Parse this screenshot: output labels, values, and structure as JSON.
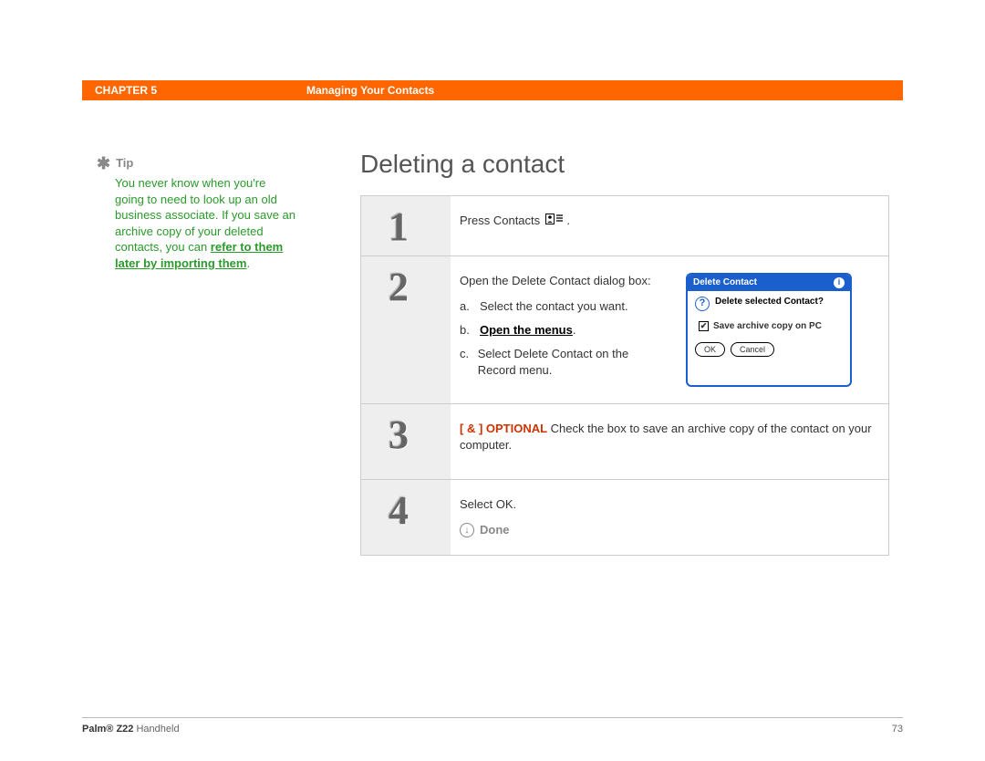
{
  "header": {
    "chapter_label": "CHAPTER 5",
    "chapter_title": "Managing Your Contacts"
  },
  "sidebar": {
    "tip_label": "Tip",
    "tip_text_before": "You never know when you're going to need to look up an old business associate. If you save an archive copy of your deleted contacts, you can ",
    "tip_link": "refer to them later by importing them",
    "tip_text_after": "."
  },
  "main": {
    "title": "Deleting a contact",
    "step1": {
      "num": "1",
      "text": "Press Contacts ",
      "after_icon": "."
    },
    "step2": {
      "num": "2",
      "intro": "Open the Delete Contact dialog box:",
      "a_letter": "a.",
      "a_text": "Select the contact you want.",
      "b_letter": "b.",
      "b_text": "Open the menus",
      "b_after": ".",
      "c_letter": "c.",
      "c_text": "Select Delete Contact on the Record menu.",
      "dialog": {
        "title": "Delete Contact",
        "msg": "Delete selected Contact?",
        "check_label": "Save archive copy on PC",
        "ok": "OK",
        "cancel": "Cancel"
      }
    },
    "step3": {
      "num": "3",
      "optional_tag": "[ & ]  OPTIONAL",
      "text": "   Check the box to save an archive copy of the contact on your computer."
    },
    "step4": {
      "num": "4",
      "text": "Select OK.",
      "done_label": "Done"
    }
  },
  "footer": {
    "product_bold": "Palm®",
    "product_rest": " Z22",
    "product_tail": " Handheld",
    "page_number": "73"
  }
}
